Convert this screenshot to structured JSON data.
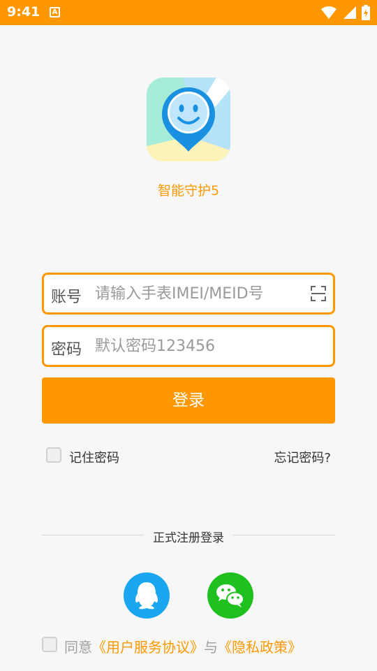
{
  "status_bar": {
    "time": "9:41",
    "notification_icon": "A",
    "icons": [
      "wifi-icon",
      "signal-icon",
      "battery-charging-icon"
    ]
  },
  "app": {
    "name": "智能守护5",
    "logo_icon": "smiley-map-pin-icon"
  },
  "form": {
    "account_label": "账号",
    "account_placeholder": "请输入手表IMEI/MEID号",
    "account_value": "",
    "password_label": "密码",
    "password_placeholder": "默认密码123456",
    "password_value": "",
    "scan_icon": "scan-icon",
    "login_button": "登录",
    "remember_label": "记住密码",
    "remember_checked": false,
    "forgot_link": "忘记密码?"
  },
  "social": {
    "divider_text": "正式注册登录",
    "providers": [
      {
        "name": "QQ",
        "icon": "qq-icon",
        "color": "#1ba7f0"
      },
      {
        "name": "WeChat",
        "icon": "wechat-icon",
        "color": "#21c021"
      }
    ]
  },
  "agreement": {
    "prefix": "同意",
    "user_agreement": "《用户服务协议》",
    "conjunction": "与",
    "privacy_policy": "《隐私政策》",
    "checked": false
  },
  "colors": {
    "accent": "#ff9800",
    "background": "#f7f7f7"
  }
}
